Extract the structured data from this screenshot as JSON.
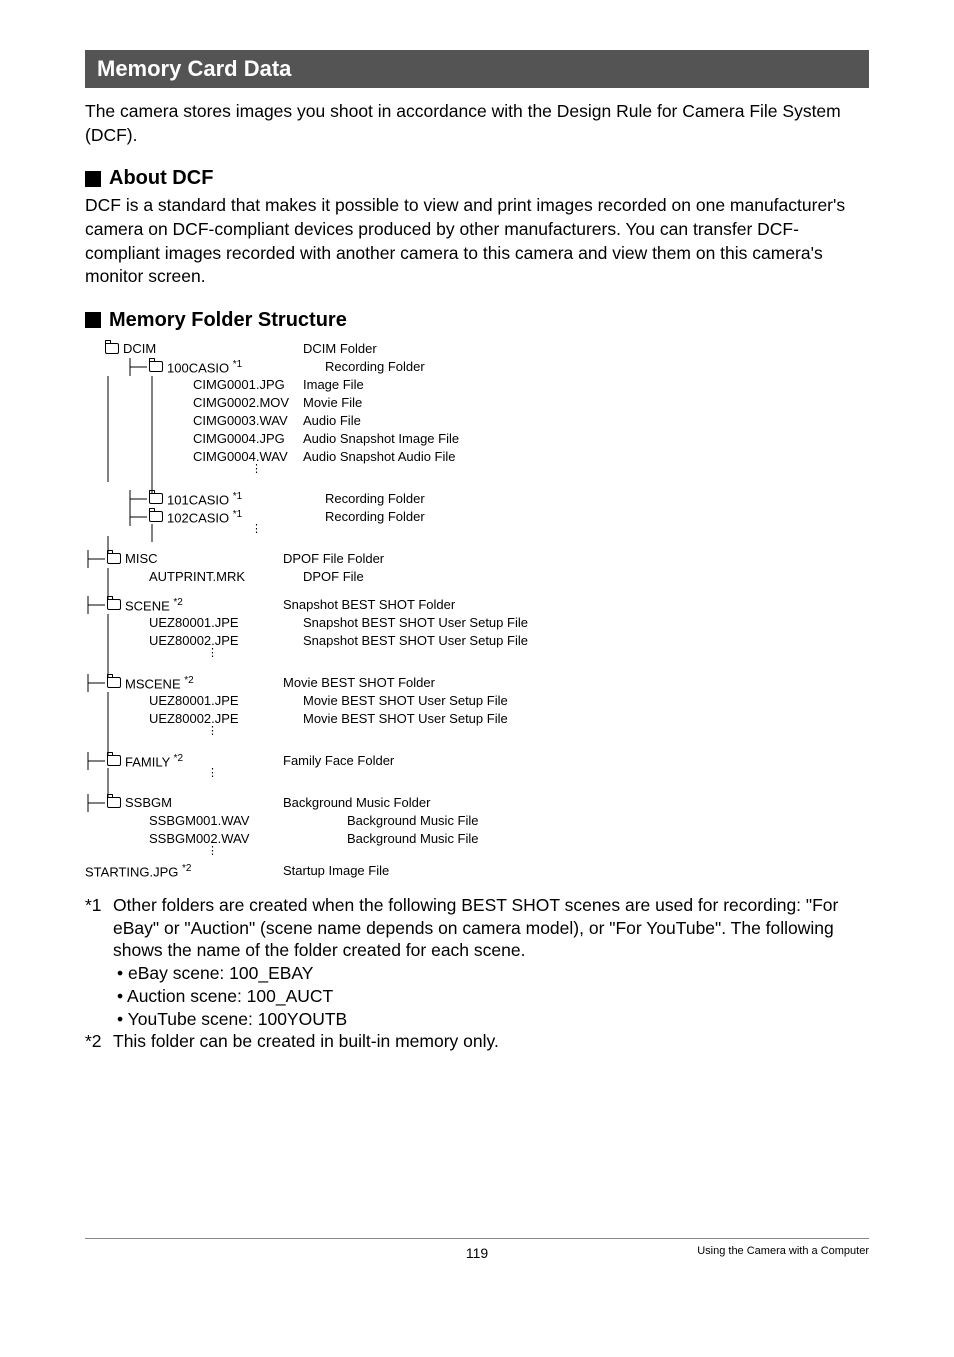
{
  "header": "Memory Card Data",
  "intro": "The camera stores images you shoot in accordance with the Design Rule for Camera File System (DCF).",
  "sub1": {
    "title": "About DCF"
  },
  "para1": "DCF is a standard that makes it possible to view and print images recorded on one manufacturer's camera on DCF-compliant devices produced by other manufacturers. You can transfer DCF-compliant images recorded with another camera to this camera and view them on this camera's monitor screen.",
  "sub2": {
    "title": "Memory Folder Structure"
  },
  "tree": [
    {
      "indent": 0,
      "folder": true,
      "pre": "",
      "label": "DCIM",
      "star": "",
      "desc": "DCIM Folder"
    },
    {
      "indent": 1,
      "folder": true,
      "pre": "t",
      "label": "100CASIO ",
      "star": "*1",
      "desc": "Recording Folder"
    },
    {
      "indent": 2,
      "folder": false,
      "pre": "bb",
      "label": "CIMG0001.JPG",
      "star": "",
      "desc": "Image File"
    },
    {
      "indent": 2,
      "folder": false,
      "pre": "bb",
      "label": "CIMG0002.MOV",
      "star": "",
      "desc": "Movie File"
    },
    {
      "indent": 2,
      "folder": false,
      "pre": "bb",
      "label": "CIMG0003.WAV",
      "star": "",
      "desc": "Audio File"
    },
    {
      "indent": 2,
      "folder": false,
      "pre": "bb",
      "label": "CIMG0004.JPG",
      "star": "",
      "desc": "Audio Snapshot Image File"
    },
    {
      "indent": 2,
      "folder": false,
      "pre": "bb",
      "label": "CIMG0004.WAV",
      "star": "",
      "desc": "Audio Snapshot Audio File"
    },
    {
      "indent": 2,
      "folder": false,
      "pre": "bb",
      "label": "",
      "star": "",
      "desc": "",
      "dots": true
    },
    {
      "indent": 2,
      "folder": false,
      "pre": "b",
      "label": "",
      "star": "",
      "desc": "",
      "spacer": true
    },
    {
      "indent": 1,
      "folder": true,
      "pre": "t",
      "label": "101CASIO ",
      "star": "*1",
      "desc": "Recording Folder"
    },
    {
      "indent": 1,
      "folder": true,
      "pre": "t",
      "label": "102CASIO ",
      "star": "*1",
      "desc": "Recording Folder"
    },
    {
      "indent": 2,
      "folder": false,
      "pre": "b",
      "label": "",
      "star": "",
      "desc": "",
      "dots": true
    },
    {
      "indent": 1,
      "folder": false,
      "pre": "b",
      "label": "",
      "star": "",
      "desc": "",
      "spacer": true
    },
    {
      "indent": 0,
      "folder": true,
      "pre": "T",
      "label": "MISC",
      "star": "",
      "desc": "DPOF File Folder"
    },
    {
      "indent": 1,
      "folder": false,
      "pre": "b",
      "label": "AUTPRINT.MRK",
      "star": "",
      "desc": "DPOF File"
    },
    {
      "indent": 1,
      "folder": false,
      "pre": "b",
      "label": "",
      "star": "",
      "desc": "",
      "spacer": true
    },
    {
      "indent": 0,
      "folder": true,
      "pre": "T",
      "label": "SCENE ",
      "star": "*2",
      "desc": "Snapshot BEST SHOT Folder"
    },
    {
      "indent": 1,
      "folder": false,
      "pre": "b",
      "label": "UEZ80001.JPE",
      "star": "",
      "desc": "Snapshot BEST SHOT User Setup File"
    },
    {
      "indent": 1,
      "folder": false,
      "pre": "b",
      "label": "UEZ80002.JPE",
      "star": "",
      "desc": "Snapshot BEST SHOT User Setup File"
    },
    {
      "indent": 1,
      "folder": false,
      "pre": "b",
      "label": "",
      "star": "",
      "desc": "",
      "dots": true
    },
    {
      "indent": 1,
      "folder": false,
      "pre": "b",
      "label": "",
      "star": "",
      "desc": "",
      "spacer": true
    },
    {
      "indent": 0,
      "folder": true,
      "pre": "T",
      "label": "MSCENE ",
      "star": "*2",
      "desc": "Movie BEST SHOT Folder"
    },
    {
      "indent": 1,
      "folder": false,
      "pre": "b",
      "label": "UEZ80001.JPE",
      "star": "",
      "desc": "Movie BEST SHOT User Setup File"
    },
    {
      "indent": 1,
      "folder": false,
      "pre": "b",
      "label": "UEZ80002.JPE",
      "star": "",
      "desc": "Movie BEST SHOT User Setup File"
    },
    {
      "indent": 1,
      "folder": false,
      "pre": "b",
      "label": "",
      "star": "",
      "desc": "",
      "dots": true
    },
    {
      "indent": 1,
      "folder": false,
      "pre": "b",
      "label": "",
      "star": "",
      "desc": "",
      "spacer": true
    },
    {
      "indent": 0,
      "folder": true,
      "pre": "T",
      "label": "FAMILY ",
      "star": "*2",
      "desc": "Family Face Folder"
    },
    {
      "indent": 1,
      "folder": false,
      "pre": "b",
      "label": "",
      "star": "",
      "desc": "",
      "dots": true
    },
    {
      "indent": 1,
      "folder": false,
      "pre": "b",
      "label": "",
      "star": "",
      "desc": "",
      "spacer": true
    },
    {
      "indent": 0,
      "folder": true,
      "pre": "T",
      "label": "SSBGM",
      "star": "",
      "desc": "Background Music Folder"
    },
    {
      "indent": 1,
      "folder": false,
      "pre": "",
      "label": "SSBGM001.WAV",
      "star": "",
      "desc": "Background Music File"
    },
    {
      "indent": 1,
      "folder": false,
      "pre": "",
      "label": "SSBGM002.WAV",
      "star": "",
      "desc": "Background Music File"
    },
    {
      "indent": 1,
      "folder": false,
      "pre": "",
      "label": "",
      "star": "",
      "desc": "",
      "dots": true
    },
    {
      "indent": -1,
      "folder": false,
      "pre": "",
      "label": "STARTING.JPG ",
      "star": "*2",
      "desc": "Startup Image File"
    }
  ],
  "fn": {
    "m1": "*1",
    "t1": "Other folders are created when the following BEST SHOT scenes are used for recording: \"For eBay\" or \"Auction\" (scene name depends on camera model), or \"For YouTube\". The following shows the name of the folder created for each scene.",
    "b1": "• eBay scene: 100_EBAY",
    "b2": "• Auction scene: 100_AUCT",
    "b3": "• YouTube scene: 100YOUTB",
    "m2": "*2",
    "t2": "This folder can be created in built-in memory only."
  },
  "footer": {
    "page": "119",
    "right": "Using the Camera with a Computer"
  }
}
